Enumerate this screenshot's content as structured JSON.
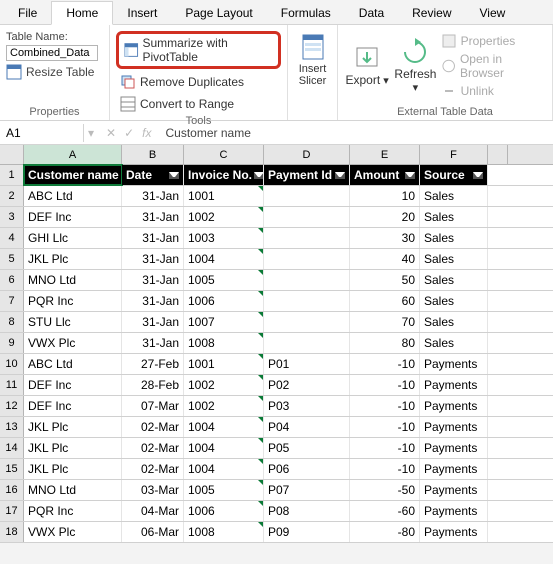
{
  "tabs": {
    "file": "File",
    "home": "Home",
    "insert": "Insert",
    "page_layout": "Page Layout",
    "formulas": "Formulas",
    "data": "Data",
    "review": "Review",
    "view": "View"
  },
  "ribbon": {
    "properties": {
      "label": "Properties",
      "table_name_label": "Table Name:",
      "table_name_value": "Combined_Data",
      "resize": "Resize Table"
    },
    "tools": {
      "label": "Tools",
      "pivot": "Summarize with PivotTable",
      "dup": "Remove Duplicates",
      "range": "Convert to Range",
      "slicer": "Insert\nSlicer"
    },
    "external": {
      "label": "External Table Data",
      "export": "Export",
      "refresh": "Refresh",
      "props": "Properties",
      "browser": "Open in Browser",
      "unlink": "Unlink"
    }
  },
  "fx": {
    "name_box": "A1",
    "formula": "Customer name"
  },
  "columns": [
    "A",
    "B",
    "C",
    "D",
    "E",
    "F"
  ],
  "headers": {
    "A": "Customer name",
    "B": "Date",
    "C": "Invoice No.",
    "D": "Payment Id",
    "E": "Amount",
    "F": "Source"
  },
  "rows": [
    {
      "n": "2",
      "A": "ABC Ltd",
      "B": "31-Jan",
      "C": "1001",
      "D": "",
      "E": "10",
      "F": "Sales"
    },
    {
      "n": "3",
      "A": "DEF Inc",
      "B": "31-Jan",
      "C": "1002",
      "D": "",
      "E": "20",
      "F": "Sales"
    },
    {
      "n": "4",
      "A": "GHI Llc",
      "B": "31-Jan",
      "C": "1003",
      "D": "",
      "E": "30",
      "F": "Sales"
    },
    {
      "n": "5",
      "A": "JKL Plc",
      "B": "31-Jan",
      "C": "1004",
      "D": "",
      "E": "40",
      "F": "Sales"
    },
    {
      "n": "6",
      "A": "MNO Ltd",
      "B": "31-Jan",
      "C": "1005",
      "D": "",
      "E": "50",
      "F": "Sales"
    },
    {
      "n": "7",
      "A": "PQR Inc",
      "B": "31-Jan",
      "C": "1006",
      "D": "",
      "E": "60",
      "F": "Sales"
    },
    {
      "n": "8",
      "A": "STU Llc",
      "B": "31-Jan",
      "C": "1007",
      "D": "",
      "E": "70",
      "F": "Sales"
    },
    {
      "n": "9",
      "A": "VWX Plc",
      "B": "31-Jan",
      "C": "1008",
      "D": "",
      "E": "80",
      "F": "Sales"
    },
    {
      "n": "10",
      "A": "ABC Ltd",
      "B": "27-Feb",
      "C": "1001",
      "D": "P01",
      "E": "-10",
      "F": "Payments"
    },
    {
      "n": "11",
      "A": "DEF Inc",
      "B": "28-Feb",
      "C": "1002",
      "D": "P02",
      "E": "-10",
      "F": "Payments"
    },
    {
      "n": "12",
      "A": "DEF Inc",
      "B": "07-Mar",
      "C": "1002",
      "D": "P03",
      "E": "-10",
      "F": "Payments"
    },
    {
      "n": "13",
      "A": "JKL Plc",
      "B": "02-Mar",
      "C": "1004",
      "D": "P04",
      "E": "-10",
      "F": "Payments"
    },
    {
      "n": "14",
      "A": "JKL Plc",
      "B": "02-Mar",
      "C": "1004",
      "D": "P05",
      "E": "-10",
      "F": "Payments"
    },
    {
      "n": "15",
      "A": "JKL Plc",
      "B": "02-Mar",
      "C": "1004",
      "D": "P06",
      "E": "-10",
      "F": "Payments"
    },
    {
      "n": "16",
      "A": "MNO Ltd",
      "B": "03-Mar",
      "C": "1005",
      "D": "P07",
      "E": "-50",
      "F": "Payments"
    },
    {
      "n": "17",
      "A": "PQR Inc",
      "B": "04-Mar",
      "C": "1006",
      "D": "P08",
      "E": "-60",
      "F": "Payments"
    },
    {
      "n": "18",
      "A": "VWX Plc",
      "B": "06-Mar",
      "C": "1008",
      "D": "P09",
      "E": "-80",
      "F": "Payments"
    }
  ]
}
